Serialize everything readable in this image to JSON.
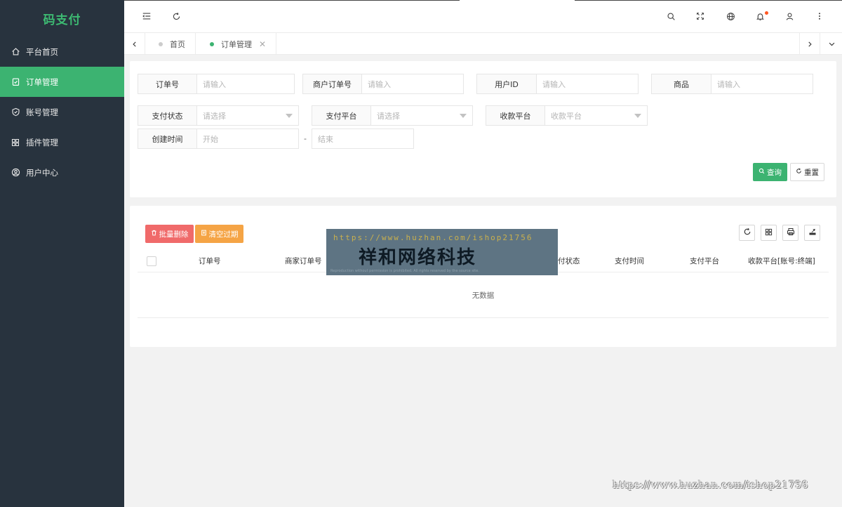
{
  "sidebar": {
    "logo": "码支付",
    "items": [
      {
        "label": "平台首页",
        "icon": "home-icon",
        "active": false
      },
      {
        "label": "订单管理",
        "icon": "clipboard-check-icon",
        "active": true
      },
      {
        "label": "账号管理",
        "icon": "shield-icon",
        "active": false
      },
      {
        "label": "插件管理",
        "icon": "grid-icon",
        "active": false
      },
      {
        "label": "用户中心",
        "icon": "user-circle-icon",
        "active": false
      }
    ]
  },
  "header": {
    "left_icons": [
      "menu-collapse-icon",
      "refresh-icon"
    ],
    "right_icons": [
      "search-icon",
      "fullscreen-icon",
      "globe-icon",
      "bell-icon",
      "user-icon",
      "more-vertical-icon"
    ]
  },
  "tabs": [
    {
      "label": "首页",
      "active": false
    },
    {
      "label": "订单管理",
      "active": true,
      "closable": true
    }
  ],
  "search": {
    "fields": {
      "order_no": {
        "label": "订单号",
        "placeholder": "请输入"
      },
      "merchant_order_no": {
        "label": "商户订单号",
        "placeholder": "请输入"
      },
      "user_id": {
        "label": "用户ID",
        "placeholder": "请输入"
      },
      "product": {
        "label": "商品",
        "placeholder": "请输入"
      },
      "pay_status": {
        "label": "支付状态",
        "placeholder": "请选择"
      },
      "pay_platform": {
        "label": "支付平台",
        "placeholder": "请选择"
      },
      "receive_platform": {
        "label": "收款平台",
        "placeholder": "收款平台"
      },
      "create_time": {
        "label": "创建时间",
        "start_placeholder": "开始",
        "separator": "-",
        "end_placeholder": "结束"
      }
    },
    "query_label": "查询",
    "reset_label": "重置"
  },
  "table": {
    "batch_delete_label": "批量删除",
    "clear_expired_label": "清空过期",
    "tools": [
      "refresh-icon",
      "columns-icon",
      "print-icon",
      "export-icon"
    ],
    "columns": [
      "订单号",
      "商家订单号",
      "付状态",
      "支付时间",
      "支付平台",
      "收款平台[账号:终端]"
    ],
    "empty_text": "无数据"
  },
  "watermark": {
    "url": "https://www.huzhan.com/ishop21756",
    "title": "祥和网络科技",
    "small_text": "Reproduction without permission is prohibited. All rights reserved by the source site.",
    "bottom_url": "https://www.huzhan.com/ishop21756"
  },
  "colors": {
    "sidebar_bg": "#28333e",
    "accent_green": "#3cb371",
    "danger": "#f06a6a",
    "warning": "#f5a445",
    "notify_dot": "#ff5722"
  }
}
